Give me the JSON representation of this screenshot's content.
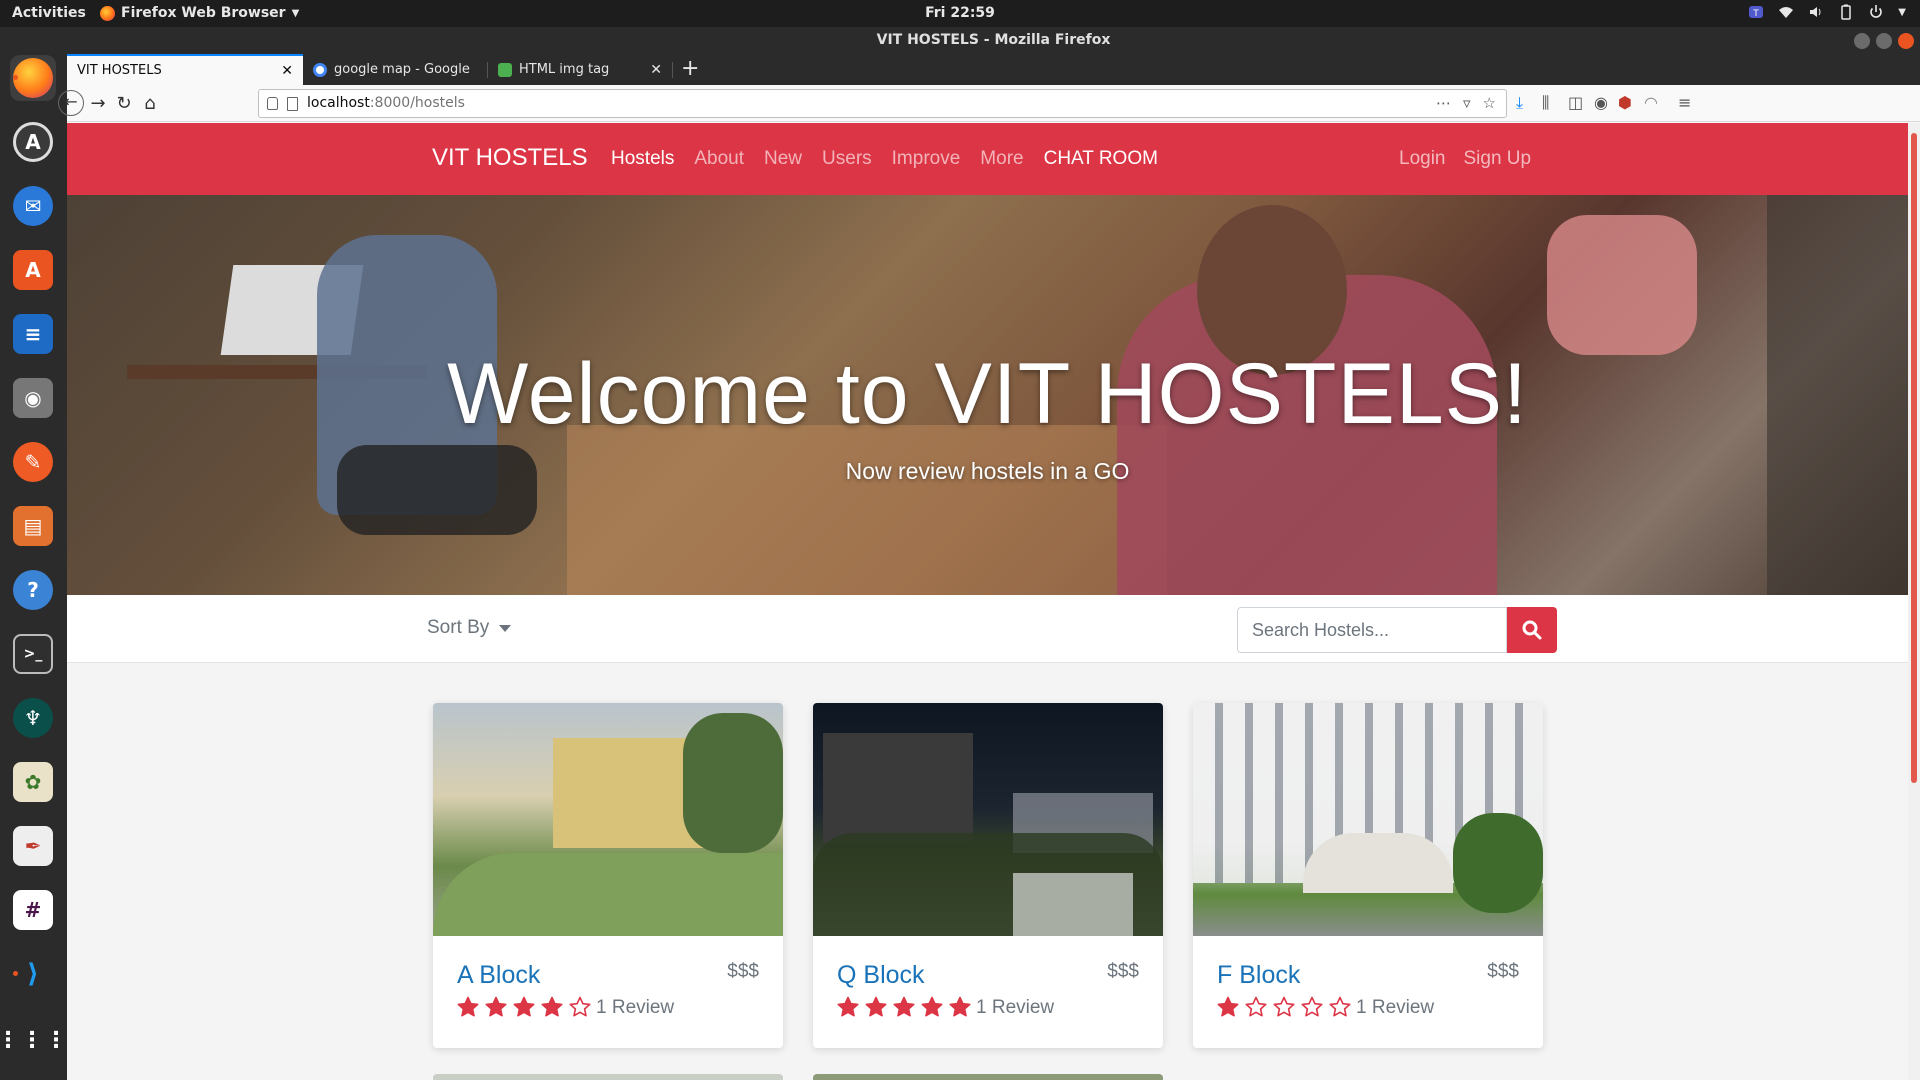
{
  "system_bar": {
    "activities": "Activities",
    "app_menu": "Firefox Web Browser",
    "clock": "Fri 22:59"
  },
  "window": {
    "title": "VIT HOSTELS - Mozilla Firefox"
  },
  "tabs": [
    {
      "label": "VIT HOSTELS",
      "selected": true,
      "favicon_color": "#ffffff"
    },
    {
      "label": "google map - Google Sea",
      "selected": false,
      "favicon_color": "#4285f4"
    },
    {
      "label": "HTML img tag",
      "selected": false,
      "favicon_color": "#4caf50"
    }
  ],
  "urlbar": {
    "host": "localhost",
    "path": ":8000/hostels"
  },
  "site": {
    "brand": "VIT HOSTELS",
    "nav": [
      "Hostels",
      "About",
      "New",
      "Users",
      "Improve",
      "More",
      "CHAT ROOM"
    ],
    "auth": [
      "Login",
      "Sign Up"
    ],
    "accent_color": "#dc3545"
  },
  "hero": {
    "title": "Welcome to VIT HOSTELS!",
    "subtitle": "Now review hostels in a GO"
  },
  "filter": {
    "sort_label": "Sort By",
    "search_placeholder": "Search Hostels..."
  },
  "hostels": [
    {
      "name": "A Block",
      "price": "$$$",
      "rating": 4,
      "reviews": "1 Review"
    },
    {
      "name": "Q Block",
      "price": "$$$",
      "rating": 5,
      "reviews": "1 Review"
    },
    {
      "name": "F Block",
      "price": "$$$",
      "rating": 1,
      "reviews": "1 Review"
    }
  ]
}
